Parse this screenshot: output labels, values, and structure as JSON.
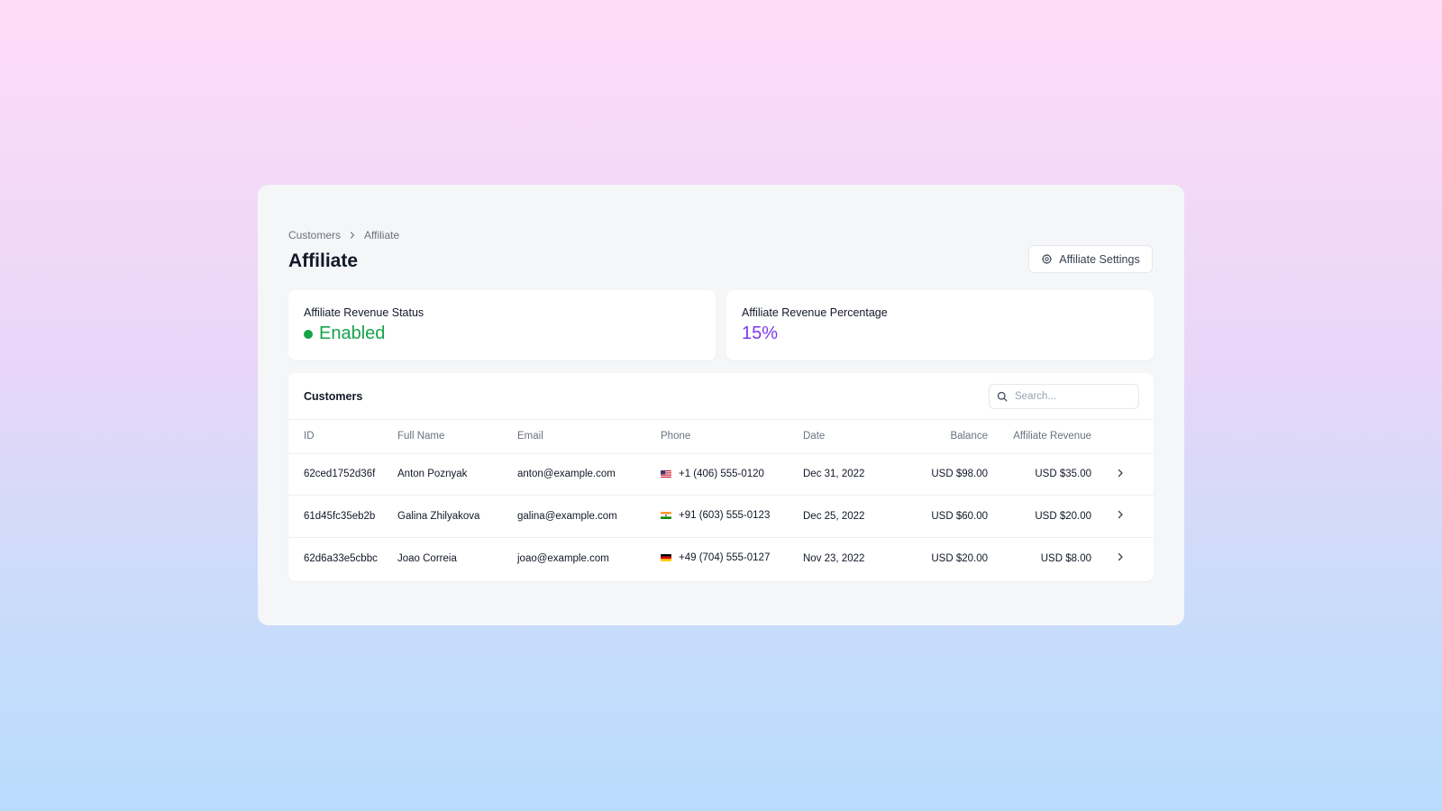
{
  "breadcrumb": {
    "parent": "Customers",
    "current": "Affiliate"
  },
  "page_title": "Affiliate",
  "settings_button": {
    "label": "Affiliate Settings",
    "icon": "gear-icon"
  },
  "stats": {
    "status": {
      "label": "Affiliate Revenue Status",
      "value": "Enabled",
      "color": "#16a34a"
    },
    "percentage": {
      "label": "Affiliate Revenue Percentage",
      "value": "15%",
      "color": "#7c3aed"
    }
  },
  "customers_table": {
    "title": "Customers",
    "search": {
      "placeholder": "Search...",
      "value": ""
    },
    "columns": [
      "ID",
      "Full Name",
      "Email",
      "Phone",
      "Date",
      "Balance",
      "Affiliate Revenue"
    ],
    "rows": [
      {
        "id": "62ced1752d36f",
        "name": "Anton Poznyak",
        "email": "anton@example.com",
        "flag": "us-flag-icon",
        "phone": "+1 (406) 555-0120",
        "date": "Dec 31, 2022",
        "balance": "USD $98.00",
        "affiliate_revenue": "USD $35.00"
      },
      {
        "id": "61d45fc35eb2b",
        "name": "Galina Zhilyakova",
        "email": "galina@example.com",
        "flag": "india-flag-icon",
        "phone": "+91 (603) 555-0123",
        "date": "Dec 25, 2022",
        "balance": "USD $60.00",
        "affiliate_revenue": "USD $20.00"
      },
      {
        "id": "62d6a33e5cbbc",
        "name": "Joao Correia",
        "email": "joao@example.com",
        "flag": "germany-flag-icon",
        "phone": "+49 (704) 555-0127",
        "date": "Nov 23, 2022",
        "balance": "USD $20.00",
        "affiliate_revenue": "USD $8.00"
      }
    ]
  }
}
